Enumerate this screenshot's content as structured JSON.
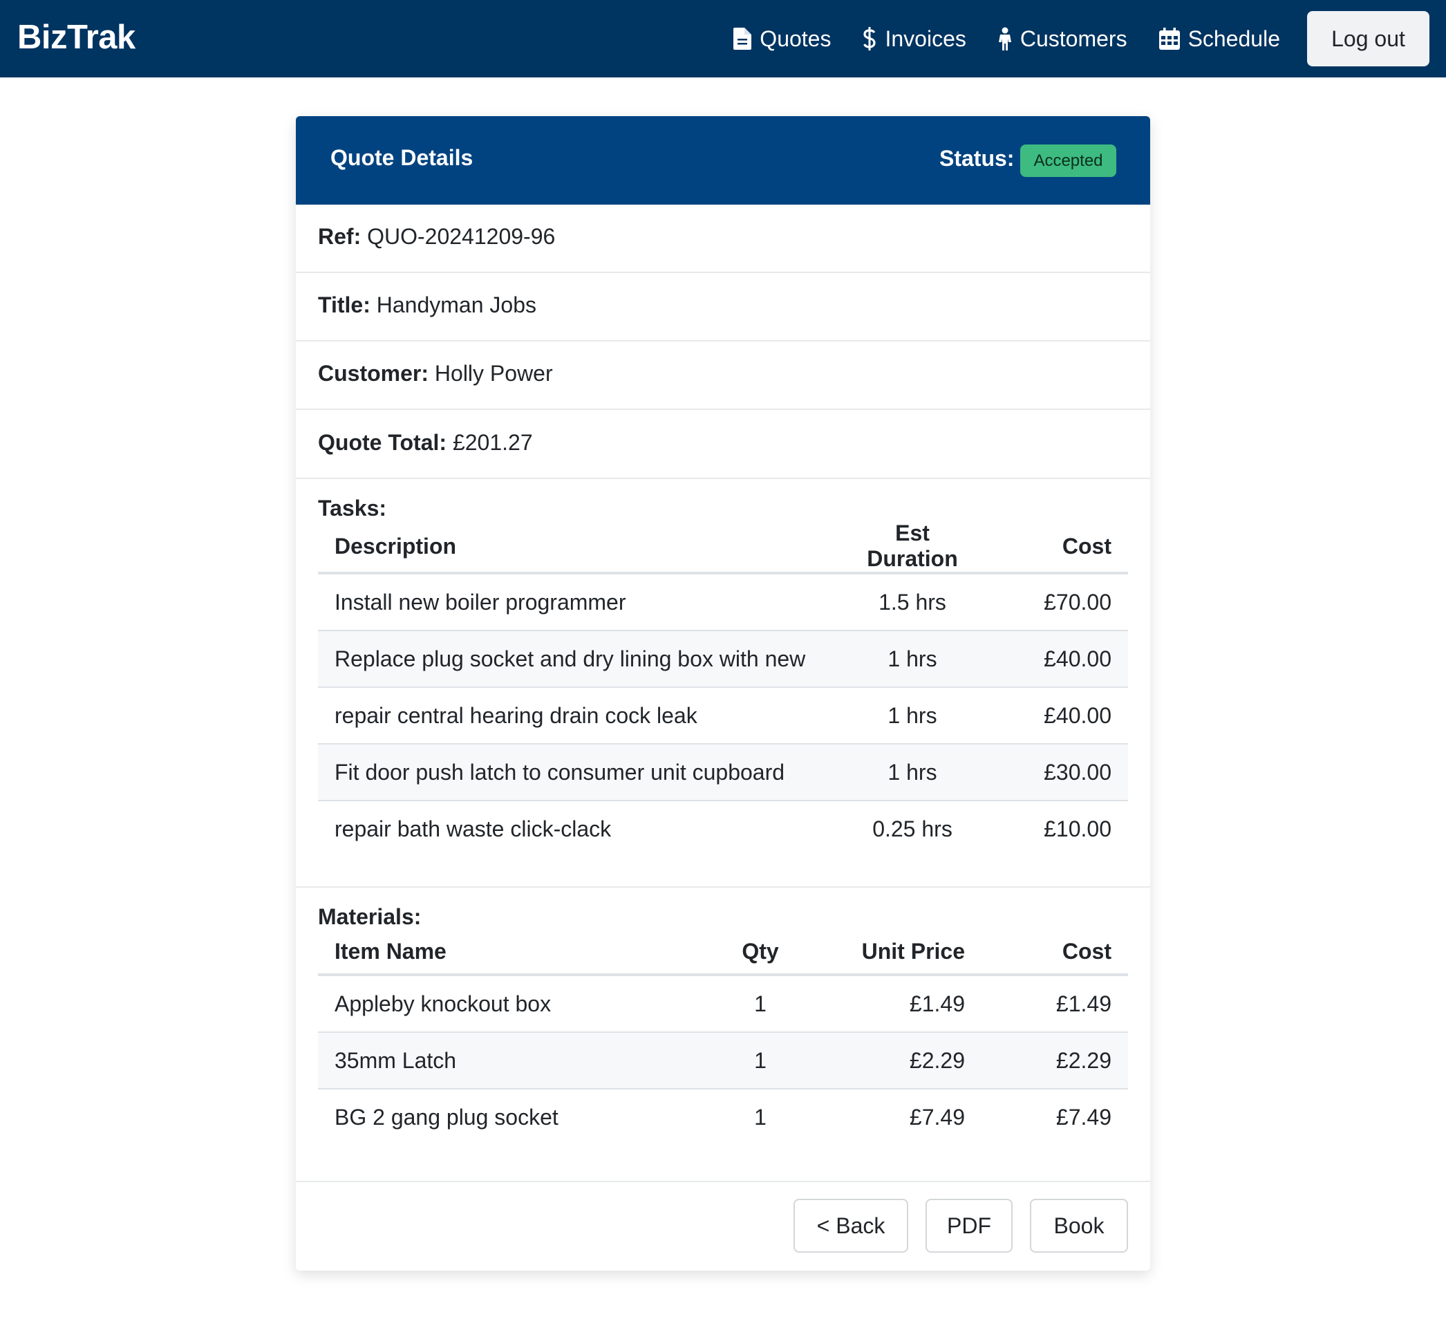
{
  "nav": {
    "brand": "BizTrak",
    "links": [
      {
        "label": "Quotes",
        "icon": "file-icon"
      },
      {
        "label": "Invoices",
        "icon": "dollar-icon"
      },
      {
        "label": "Customers",
        "icon": "person-icon"
      },
      {
        "label": "Schedule",
        "icon": "calendar-icon"
      }
    ],
    "logout": "Log out"
  },
  "quote": {
    "header_title": "Quote Details",
    "status_label": "Status:",
    "status": "Accepted",
    "ref_label": "Ref:",
    "ref": "QUO-20241209-96",
    "title_label": "Title:",
    "title": "Handyman Jobs",
    "customer_label": "Customer:",
    "customer": "Holly Power",
    "total_label": "Quote Total:",
    "total": "£201.27"
  },
  "tasks": {
    "label": "Tasks:",
    "headers": [
      "Description",
      "Est Duration",
      "Cost"
    ],
    "rows": [
      {
        "description": "Install new boiler programmer",
        "duration": "1.5 hrs",
        "cost": "£70.00"
      },
      {
        "description": "Replace plug socket and dry lining box with new",
        "duration": "1 hrs",
        "cost": "£40.00"
      },
      {
        "description": "repair central hearing drain cock leak",
        "duration": "1 hrs",
        "cost": "£40.00"
      },
      {
        "description": "Fit door push latch to consumer unit cupboard",
        "duration": "1 hrs",
        "cost": "£30.00"
      },
      {
        "description": "repair bath waste click-clack",
        "duration": "0.25 hrs",
        "cost": "£10.00"
      }
    ]
  },
  "materials": {
    "label": "Materials:",
    "headers": [
      "Item Name",
      "Qty",
      "Unit Price",
      "Cost"
    ],
    "rows": [
      {
        "name": "Appleby knockout box",
        "qty": "1",
        "unit_price": "£1.49",
        "cost": "£1.49"
      },
      {
        "name": "35mm Latch",
        "qty": "1",
        "unit_price": "£2.29",
        "cost": "£2.29"
      },
      {
        "name": "BG 2 gang plug socket",
        "qty": "1",
        "unit_price": "£7.49",
        "cost": "£7.49"
      }
    ]
  },
  "actions": {
    "back": "< Back",
    "pdf": "PDF",
    "book": "Book"
  },
  "colors": {
    "navbar": "#003461",
    "card_header": "#014380",
    "status_badge": "#3dbb81"
  }
}
